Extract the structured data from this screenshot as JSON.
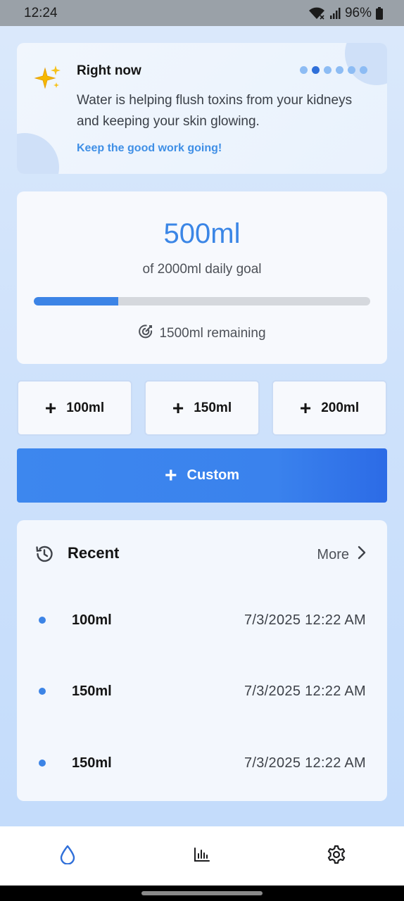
{
  "status_bar": {
    "time": "12:24",
    "battery": "96%",
    "icons": [
      "wifi-icon",
      "signal-icon",
      "battery-icon"
    ]
  },
  "insight": {
    "icon": "sparkles-icon",
    "title": "Right now",
    "message": "Water is helping flush toxins from your kidneys and keeping your skin glowing.",
    "cta": "Keep the good work going!",
    "carousel": {
      "count": 6,
      "active_index": 1
    }
  },
  "progress": {
    "amount": "500ml",
    "goal_text": "of 2000ml daily goal",
    "fraction": 0.25,
    "remaining": "1500ml remaining",
    "remaining_icon": "target-icon"
  },
  "quick_add": [
    {
      "label": "100ml",
      "icon": "plus-icon"
    },
    {
      "label": "150ml",
      "icon": "plus-icon"
    },
    {
      "label": "200ml",
      "icon": "plus-icon"
    }
  ],
  "custom": {
    "label": "Custom",
    "icon": "plus-icon"
  },
  "recent": {
    "title": "Recent",
    "icon": "history-icon",
    "more_label": "More",
    "entries": [
      {
        "volume": "100ml",
        "time": "7/3/2025 12:22 AM"
      },
      {
        "volume": "150ml",
        "time": "7/3/2025 12:22 AM"
      },
      {
        "volume": "150ml",
        "time": "7/3/2025 12:22 AM"
      }
    ]
  },
  "bottom_nav": [
    {
      "name": "drop-icon",
      "active": true
    },
    {
      "name": "bar-chart-icon",
      "active": false
    },
    {
      "name": "settings-icon",
      "active": false
    }
  ],
  "colors": {
    "accent": "#3b86e6",
    "progress_fill": "#3c84e6",
    "progress_track": "#d5d8dd",
    "cta_text": "#3f8fe6",
    "custom_button": "#3a82ed"
  }
}
